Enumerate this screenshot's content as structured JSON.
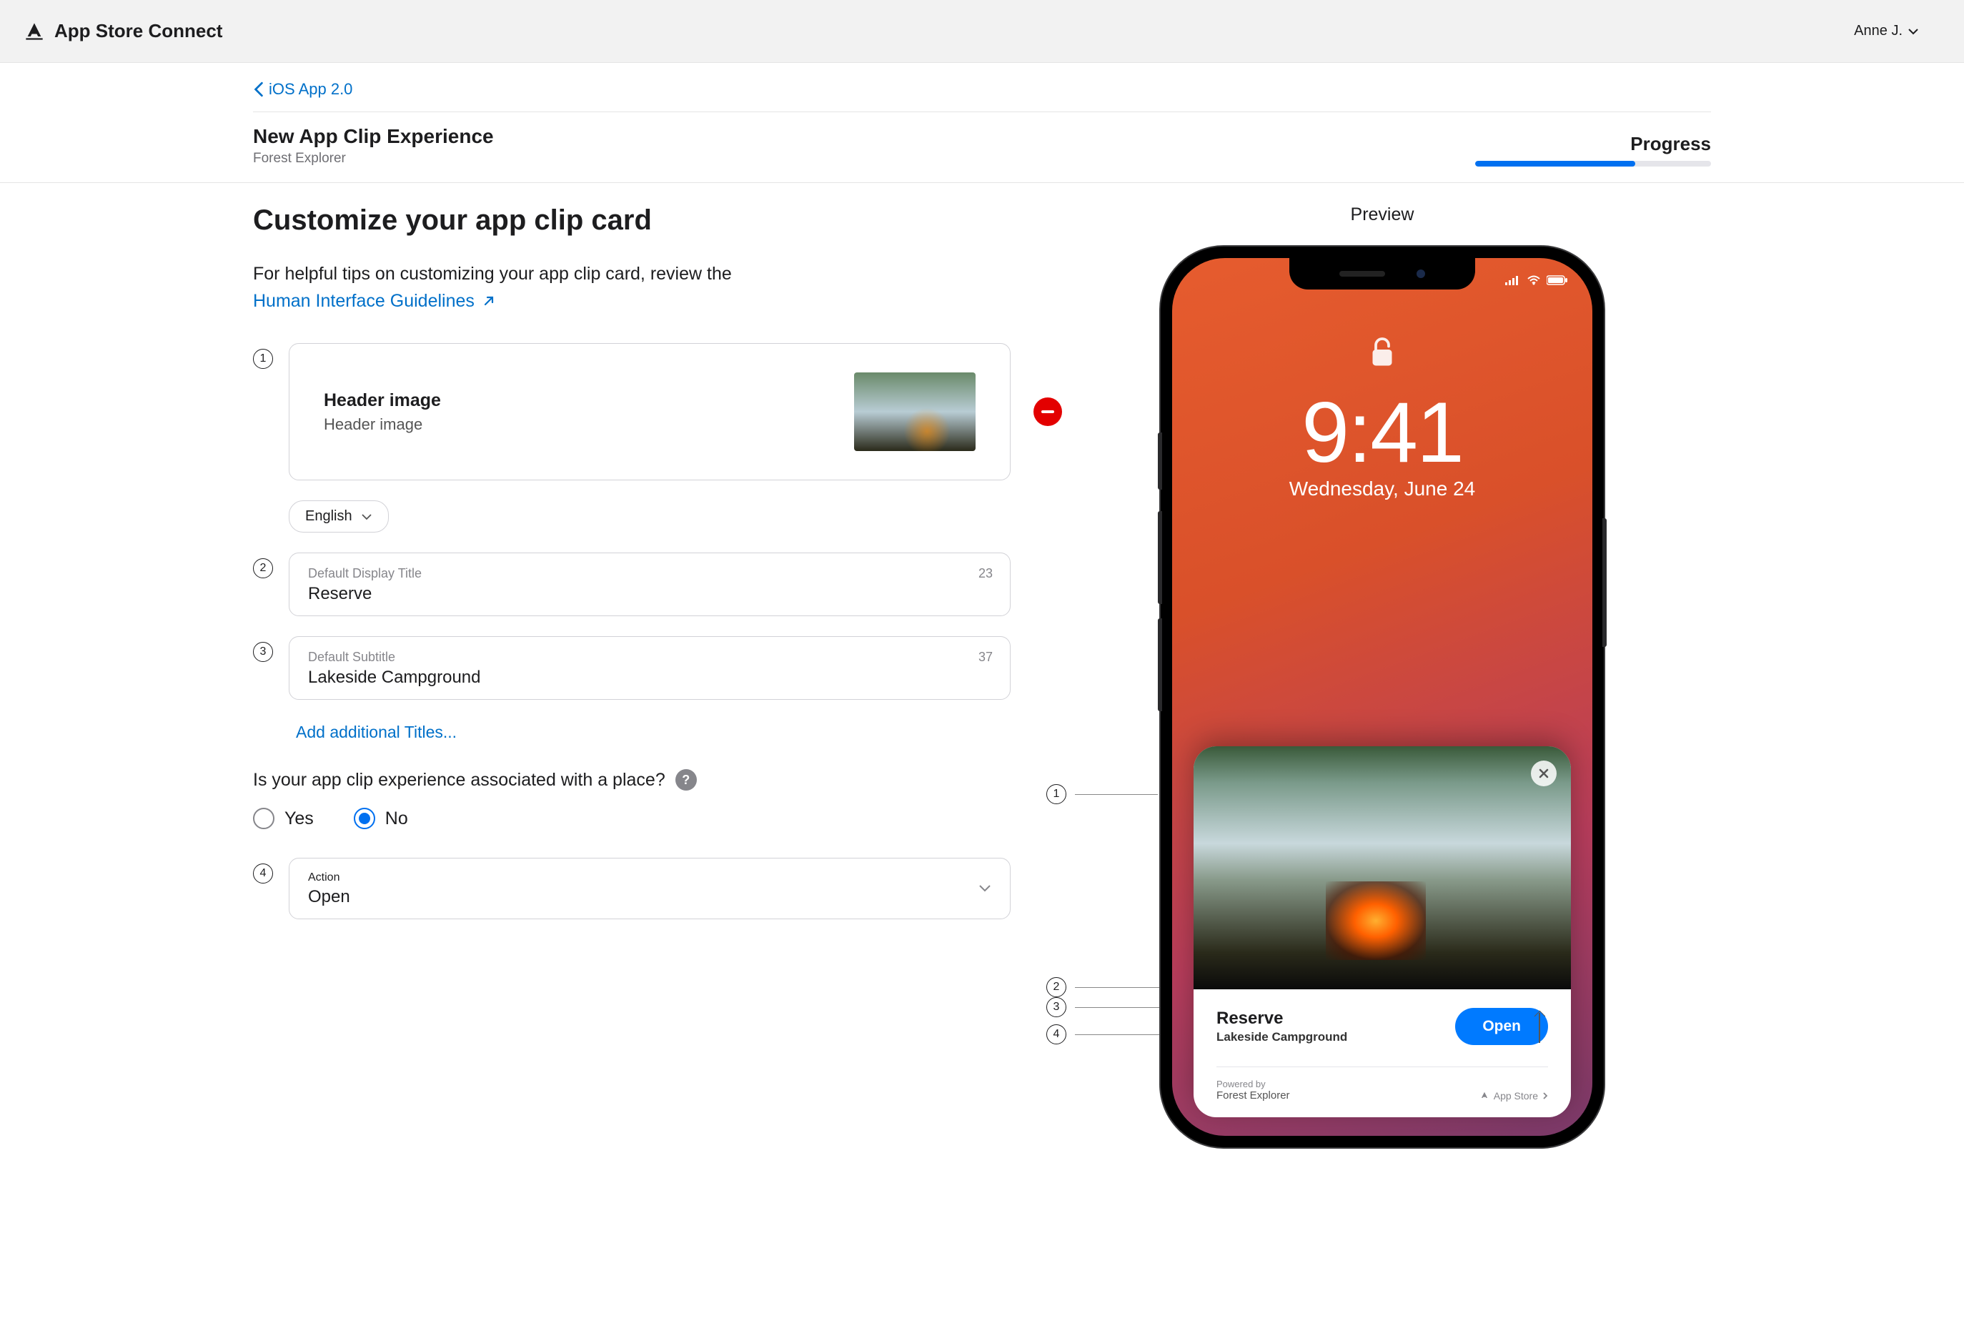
{
  "topbar": {
    "title": "App Store Connect",
    "user": "Anne J."
  },
  "back": {
    "label": "iOS App 2.0"
  },
  "header": {
    "title": "New App Clip Experience",
    "subtitle": "Forest Explorer",
    "progress_label": "Progress",
    "progress_percent": 68
  },
  "section": {
    "title": "Customize your app clip card",
    "hint_pre": "For helpful tips on customizing your app clip card, review the ",
    "hint_link": "Human Interface Guidelines"
  },
  "header_image": {
    "title": "Header image",
    "subtitle": "Header image"
  },
  "language": {
    "selected": "English"
  },
  "fields": {
    "title_label": "Default Display Title",
    "title_value": "Reserve",
    "title_counter": "23",
    "subtitle_label": "Default Subtitle",
    "subtitle_value": "Lakeside Campground",
    "subtitle_counter": "37",
    "add_titles": "Add additional Titles..."
  },
  "place_question": {
    "text": "Is your app clip experience associated with a place?",
    "yes": "Yes",
    "no": "No",
    "selected": "no"
  },
  "action": {
    "label": "Action",
    "value": "Open"
  },
  "preview": {
    "label": "Preview",
    "lock_time": "9:41",
    "lock_date": "Wednesday, June 24",
    "card": {
      "title": "Reserve",
      "subtitle": "Lakeside Campground",
      "button": "Open",
      "powered_by": "Powered by",
      "app_name": "Forest Explorer",
      "store": "App Store"
    }
  },
  "steps": {
    "s1": "1",
    "s2": "2",
    "s3": "3",
    "s4": "4"
  }
}
